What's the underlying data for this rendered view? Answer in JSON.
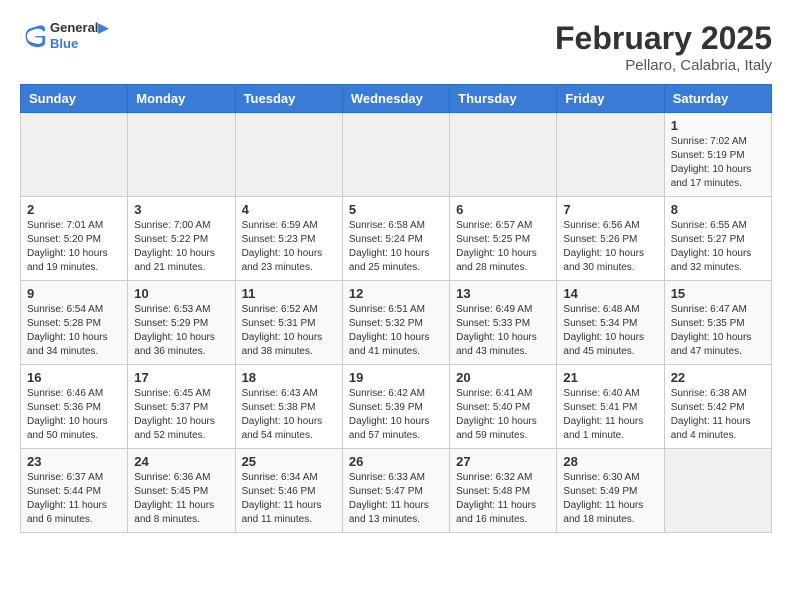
{
  "header": {
    "logo_general": "General",
    "logo_blue": "Blue",
    "month": "February 2025",
    "location": "Pellaro, Calabria, Italy"
  },
  "days_of_week": [
    "Sunday",
    "Monday",
    "Tuesday",
    "Wednesday",
    "Thursday",
    "Friday",
    "Saturday"
  ],
  "weeks": [
    [
      {
        "day": "",
        "info": ""
      },
      {
        "day": "",
        "info": ""
      },
      {
        "day": "",
        "info": ""
      },
      {
        "day": "",
        "info": ""
      },
      {
        "day": "",
        "info": ""
      },
      {
        "day": "",
        "info": ""
      },
      {
        "day": "1",
        "info": "Sunrise: 7:02 AM\nSunset: 5:19 PM\nDaylight: 10 hours\nand 17 minutes."
      }
    ],
    [
      {
        "day": "2",
        "info": "Sunrise: 7:01 AM\nSunset: 5:20 PM\nDaylight: 10 hours\nand 19 minutes."
      },
      {
        "day": "3",
        "info": "Sunrise: 7:00 AM\nSunset: 5:22 PM\nDaylight: 10 hours\nand 21 minutes."
      },
      {
        "day": "4",
        "info": "Sunrise: 6:59 AM\nSunset: 5:23 PM\nDaylight: 10 hours\nand 23 minutes."
      },
      {
        "day": "5",
        "info": "Sunrise: 6:58 AM\nSunset: 5:24 PM\nDaylight: 10 hours\nand 25 minutes."
      },
      {
        "day": "6",
        "info": "Sunrise: 6:57 AM\nSunset: 5:25 PM\nDaylight: 10 hours\nand 28 minutes."
      },
      {
        "day": "7",
        "info": "Sunrise: 6:56 AM\nSunset: 5:26 PM\nDaylight: 10 hours\nand 30 minutes."
      },
      {
        "day": "8",
        "info": "Sunrise: 6:55 AM\nSunset: 5:27 PM\nDaylight: 10 hours\nand 32 minutes."
      }
    ],
    [
      {
        "day": "9",
        "info": "Sunrise: 6:54 AM\nSunset: 5:28 PM\nDaylight: 10 hours\nand 34 minutes."
      },
      {
        "day": "10",
        "info": "Sunrise: 6:53 AM\nSunset: 5:29 PM\nDaylight: 10 hours\nand 36 minutes."
      },
      {
        "day": "11",
        "info": "Sunrise: 6:52 AM\nSunset: 5:31 PM\nDaylight: 10 hours\nand 38 minutes."
      },
      {
        "day": "12",
        "info": "Sunrise: 6:51 AM\nSunset: 5:32 PM\nDaylight: 10 hours\nand 41 minutes."
      },
      {
        "day": "13",
        "info": "Sunrise: 6:49 AM\nSunset: 5:33 PM\nDaylight: 10 hours\nand 43 minutes."
      },
      {
        "day": "14",
        "info": "Sunrise: 6:48 AM\nSunset: 5:34 PM\nDaylight: 10 hours\nand 45 minutes."
      },
      {
        "day": "15",
        "info": "Sunrise: 6:47 AM\nSunset: 5:35 PM\nDaylight: 10 hours\nand 47 minutes."
      }
    ],
    [
      {
        "day": "16",
        "info": "Sunrise: 6:46 AM\nSunset: 5:36 PM\nDaylight: 10 hours\nand 50 minutes."
      },
      {
        "day": "17",
        "info": "Sunrise: 6:45 AM\nSunset: 5:37 PM\nDaylight: 10 hours\nand 52 minutes."
      },
      {
        "day": "18",
        "info": "Sunrise: 6:43 AM\nSunset: 5:38 PM\nDaylight: 10 hours\nand 54 minutes."
      },
      {
        "day": "19",
        "info": "Sunrise: 6:42 AM\nSunset: 5:39 PM\nDaylight: 10 hours\nand 57 minutes."
      },
      {
        "day": "20",
        "info": "Sunrise: 6:41 AM\nSunset: 5:40 PM\nDaylight: 10 hours\nand 59 minutes."
      },
      {
        "day": "21",
        "info": "Sunrise: 6:40 AM\nSunset: 5:41 PM\nDaylight: 11 hours\nand 1 minute."
      },
      {
        "day": "22",
        "info": "Sunrise: 6:38 AM\nSunset: 5:42 PM\nDaylight: 11 hours\nand 4 minutes."
      }
    ],
    [
      {
        "day": "23",
        "info": "Sunrise: 6:37 AM\nSunset: 5:44 PM\nDaylight: 11 hours\nand 6 minutes."
      },
      {
        "day": "24",
        "info": "Sunrise: 6:36 AM\nSunset: 5:45 PM\nDaylight: 11 hours\nand 8 minutes."
      },
      {
        "day": "25",
        "info": "Sunrise: 6:34 AM\nSunset: 5:46 PM\nDaylight: 11 hours\nand 11 minutes."
      },
      {
        "day": "26",
        "info": "Sunrise: 6:33 AM\nSunset: 5:47 PM\nDaylight: 11 hours\nand 13 minutes."
      },
      {
        "day": "27",
        "info": "Sunrise: 6:32 AM\nSunset: 5:48 PM\nDaylight: 11 hours\nand 16 minutes."
      },
      {
        "day": "28",
        "info": "Sunrise: 6:30 AM\nSunset: 5:49 PM\nDaylight: 11 hours\nand 18 minutes."
      },
      {
        "day": "",
        "info": ""
      }
    ]
  ]
}
